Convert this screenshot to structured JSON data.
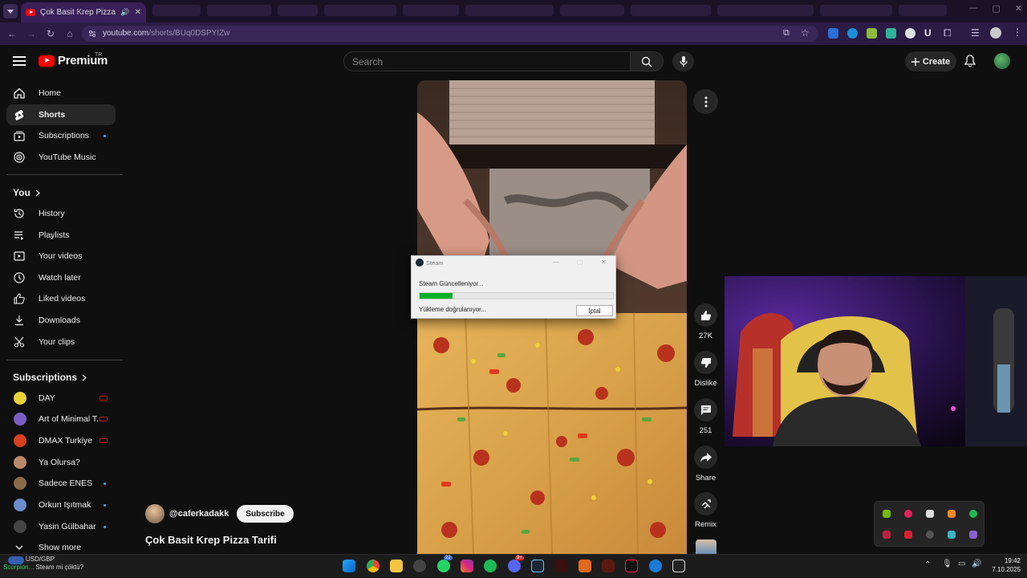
{
  "browser": {
    "tab_title": "Çok Basit Krep Pizza Tarifi",
    "url_host": "youtube.com",
    "url_path": "/shorts/BUq0DSPYIZw"
  },
  "header": {
    "brand": "Premium",
    "country": "TR",
    "search_placeholder": "Search",
    "create_label": "Create"
  },
  "sidebar": {
    "primary": [
      {
        "label": "Home",
        "icon": "home-icon"
      },
      {
        "label": "Shorts",
        "icon": "shorts-icon",
        "active": true
      },
      {
        "label": "Subscriptions",
        "icon": "subscriptions-icon",
        "new": true
      },
      {
        "label": "YouTube Music",
        "icon": "music-icon"
      }
    ],
    "you_heading": "You",
    "you_items": [
      {
        "label": "History",
        "icon": "history-icon"
      },
      {
        "label": "Playlists",
        "icon": "playlists-icon"
      },
      {
        "label": "Your videos",
        "icon": "your-videos-icon"
      },
      {
        "label": "Watch later",
        "icon": "watch-later-icon"
      },
      {
        "label": "Liked videos",
        "icon": "liked-icon"
      },
      {
        "label": "Downloads",
        "icon": "download-icon"
      },
      {
        "label": "Your clips",
        "icon": "clips-icon"
      }
    ],
    "subs_heading": "Subscriptions",
    "subscriptions": [
      {
        "label": "DAY",
        "badge": "live",
        "color": "#e8d43a"
      },
      {
        "label": "Art of Minimal T...",
        "badge": "live",
        "color": "#7a5fc2"
      },
      {
        "label": "DMAX Turkiye",
        "badge": "live",
        "color": "#d8401f"
      },
      {
        "label": "Ya Olursa?",
        "badge": "",
        "color": "#b98a6a"
      },
      {
        "label": "Sadece ENES",
        "badge": "new",
        "color": "#8a6a4a"
      },
      {
        "label": "Orkun Işıtmak",
        "badge": "new",
        "color": "#6b8ccf"
      },
      {
        "label": "Yasin Gülbahar",
        "badge": "new",
        "color": "#444"
      }
    ],
    "show_more": "Show more"
  },
  "short": {
    "channel": "@caferkadakk",
    "subscribe_label": "Subscribe",
    "title": "Çok Basit Krep Pizza Tarifi",
    "likes": "27K",
    "dislike_label": "Dislike",
    "comments": "251",
    "share_label": "Share",
    "remix_label": "Remix"
  },
  "steam_dialog": {
    "title": "Steam",
    "message": "Steam Güncelleniyor...",
    "status": "Yükleme doğrulanıyor...",
    "cancel_label": "İptal",
    "progress": 0.17
  },
  "taskbar": {
    "ticker_symbol": "USD/GBP",
    "ticker_sub": "Steam mi çöktü?",
    "ticker_name": "Scorpion...",
    "time": "19:42",
    "date": "7.10.2025",
    "badges": {
      "whatsapp": "22",
      "discord": "9+"
    }
  },
  "colors": {
    "accent_red": "#ff0000",
    "browser_purple": "#2b1b45",
    "steam_green": "#06b025",
    "new_dot": "#3ea6ff"
  }
}
